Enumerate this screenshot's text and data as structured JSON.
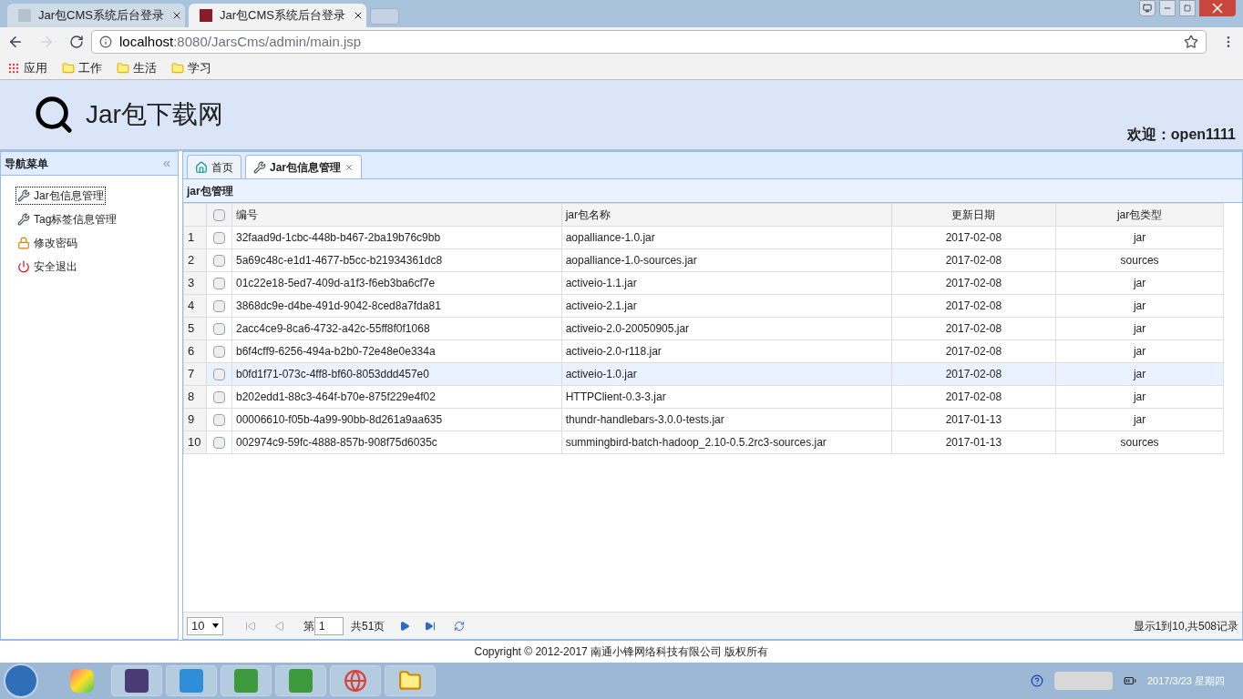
{
  "browser": {
    "tabs": [
      {
        "title": "Jar包CMS系统后台登录",
        "selected": false
      },
      {
        "title": "Jar包CMS系统后台登录",
        "selected": true
      }
    ],
    "url_host": "localhost",
    "url_path": ":8080/JarsCms/admin/main.jsp",
    "bookmarks": [
      {
        "kind": "apps",
        "label": "应用"
      },
      {
        "kind": "folder",
        "label": "工作"
      },
      {
        "kind": "folder",
        "label": "生活"
      },
      {
        "kind": "folder",
        "label": "学习"
      }
    ]
  },
  "header": {
    "title": "Jar包下载网",
    "welcome": "欢迎：open1111"
  },
  "nav": {
    "title": "导航菜单",
    "collapse": "«",
    "items": [
      {
        "kind": "tools",
        "label": "Jar包信息管理",
        "selected": true
      },
      {
        "kind": "tools",
        "label": "Tag标签信息管理",
        "selected": false
      },
      {
        "kind": "lock",
        "label": "修改密码",
        "selected": false
      },
      {
        "kind": "exit",
        "label": "安全退出",
        "selected": false
      }
    ]
  },
  "tabs": [
    {
      "kind": "home",
      "label": "首页",
      "selected": false,
      "closable": false
    },
    {
      "kind": "tools",
      "label": "Jar包信息管理",
      "selected": true,
      "closable": true
    }
  ],
  "panel_title": "jar包管理",
  "table": {
    "all_checked": false,
    "columns": [
      "编号",
      "jar包名称",
      "更新日期",
      "jar包类型"
    ],
    "rows": [
      {
        "num": "1",
        "id": "32faad9d-1cbc-448b-b467-2ba19b76c9bb",
        "name": "aopalliance-1.0.jar",
        "date": "2017-02-08",
        "type": "jar",
        "checked": false,
        "selected": false
      },
      {
        "num": "2",
        "id": "5a69c48c-e1d1-4677-b5cc-b21934361dc8",
        "name": "aopalliance-1.0-sources.jar",
        "date": "2017-02-08",
        "type": "sources",
        "checked": false,
        "selected": false
      },
      {
        "num": "3",
        "id": "01c22e18-5ed7-409d-a1f3-f6eb3ba6cf7e",
        "name": "activeio-1.1.jar",
        "date": "2017-02-08",
        "type": "jar",
        "checked": false,
        "selected": false
      },
      {
        "num": "4",
        "id": "3868dc9e-d4be-491d-9042-8ced8a7fda81",
        "name": "activeio-2.1.jar",
        "date": "2017-02-08",
        "type": "jar",
        "checked": false,
        "selected": false
      },
      {
        "num": "5",
        "id": "2acc4ce9-8ca6-4732-a42c-55ff8f0f1068",
        "name": "activeio-2.0-20050905.jar",
        "date": "2017-02-08",
        "type": "jar",
        "checked": false,
        "selected": false
      },
      {
        "num": "6",
        "id": "b6f4cff9-6256-494a-b2b0-72e48e0e334a",
        "name": "activeio-2.0-r118.jar",
        "date": "2017-02-08",
        "type": "jar",
        "checked": false,
        "selected": false
      },
      {
        "num": "7",
        "id": "b0fd1f71-073c-4ff8-bf60-8053ddd457e0",
        "name": "activeio-1.0.jar",
        "date": "2017-02-08",
        "type": "jar",
        "checked": false,
        "selected": true
      },
      {
        "num": "8",
        "id": "b202edd1-88c3-464f-b70e-875f229e4f02",
        "name": "HTTPClient-0.3-3.jar",
        "date": "2017-02-08",
        "type": "jar",
        "checked": false,
        "selected": false
      },
      {
        "num": "9",
        "id": "00006610-f05b-4a99-90bb-8d261a9aa635",
        "name": "thundr-handlebars-3.0.0-tests.jar",
        "date": "2017-01-13",
        "type": "jar",
        "checked": false,
        "selected": false
      },
      {
        "num": "10",
        "id": "002974c9-59fc-4888-857b-908f75d6035c",
        "name": "summingbird-batch-hadoop_2.10-0.5.2rc3-sources.jar",
        "date": "2017-01-13",
        "type": "sources",
        "checked": false,
        "selected": false
      }
    ]
  },
  "pager": {
    "page_size": "10",
    "page_label": "第",
    "page": "1",
    "total_pages": "共51页",
    "summary": "显示1到10,共508记录"
  },
  "footer": "Copyright © 2012-2017 南通小锋网络科技有限公司 版权所有",
  "taskbar": {
    "date": "2017/3/23 星期四"
  }
}
